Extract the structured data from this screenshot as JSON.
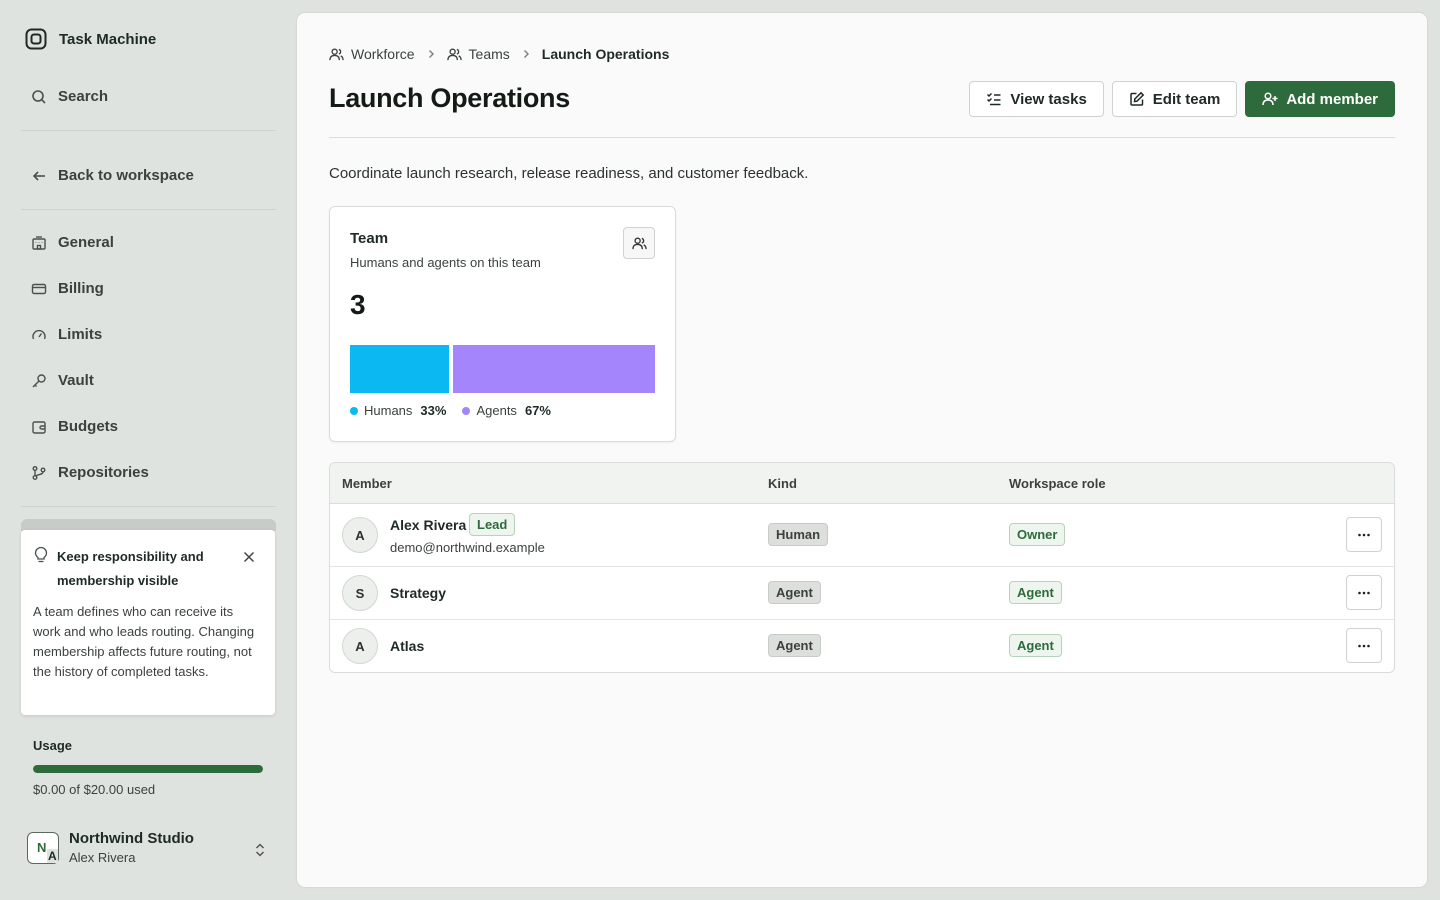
{
  "app": {
    "title": "Task Machine",
    "logo_icon": "app-logo-icon"
  },
  "sidebar": {
    "search_label": "Search",
    "back_label": "Back to workspace",
    "items": [
      {
        "label": "General",
        "icon": "building-icon"
      },
      {
        "label": "Billing",
        "icon": "credit-card-icon"
      },
      {
        "label": "Limits",
        "icon": "gauge-icon"
      },
      {
        "label": "Vault",
        "icon": "key-icon"
      },
      {
        "label": "Budgets",
        "icon": "wallet-icon"
      },
      {
        "label": "Repositories",
        "icon": "git-branch-icon"
      }
    ],
    "tip": {
      "title": "Keep responsibility and membership visible",
      "body": "A team defines who can receive its work and who leads routing. Changing membership affects future routing, not the history of completed tasks."
    },
    "usage": {
      "label": "Usage",
      "text": "$0.00 of $20.00 used",
      "fill_percent": 100,
      "color": "#2e6b3c"
    },
    "account": {
      "org_initial": "N",
      "user_initial": "A",
      "org_name": "Northwind Studio",
      "user_name": "Alex Rivera"
    }
  },
  "main": {
    "breadcrumb": {
      "workforce": "Workforce",
      "teams": "Teams",
      "current": "Launch Operations"
    },
    "title": "Launch Operations",
    "actions": {
      "view_tasks": "View tasks",
      "edit_team": "Edit team",
      "add_member": "Add member"
    },
    "description": "Coordinate launch research, release readiness, and customer feedback.",
    "team_card": {
      "title": "Team",
      "subtitle": "Humans and agents on this team",
      "count": "3",
      "segments": [
        {
          "label": "Humans",
          "percent_text": "33%",
          "value": 33,
          "color": "#0cb8f2"
        },
        {
          "label": "Agents",
          "percent_text": "67%",
          "value": 67,
          "color": "#a585fb"
        }
      ]
    },
    "table": {
      "headers": {
        "member": "Member",
        "kind": "Kind",
        "role": "Workspace role"
      },
      "rows": [
        {
          "initial": "A",
          "name": "Alex Rivera",
          "badge": "Lead",
          "email": "demo@northwind.example",
          "kind": "Human",
          "role": "Owner"
        },
        {
          "initial": "S",
          "name": "Strategy",
          "kind": "Agent",
          "role": "Agent"
        },
        {
          "initial": "A",
          "name": "Atlas",
          "kind": "Agent",
          "role": "Agent"
        }
      ]
    }
  },
  "colors": {
    "primary": "#2e6b3c",
    "sidebar_bg": "#dfe3df",
    "panel_bg": "#fafafa"
  }
}
